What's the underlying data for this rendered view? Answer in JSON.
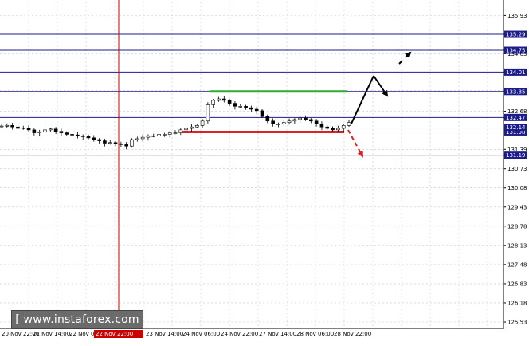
{
  "chart_data": {
    "type": "candlestick",
    "instrument_note": "",
    "y_axis": {
      "ylim": [
        125.53,
        136.4
      ],
      "tick_labels": [
        "135.93",
        "134.63",
        "133.38",
        "132.68",
        "131.39",
        "130.73",
        "130.08",
        "129.43",
        "128.78",
        "128.13",
        "127.48",
        "126.83",
        "126.18",
        "125.53"
      ],
      "tick_values": [
        135.93,
        134.63,
        133.38,
        132.68,
        131.39,
        130.73,
        130.08,
        129.43,
        128.78,
        128.13,
        127.48,
        126.83,
        126.18,
        125.53
      ]
    },
    "x_axis": {
      "tick_labels": [
        "20 Nov 22:00",
        "21 Nov 14:00",
        "22 Nov 06:00",
        "23 Nov 14:00",
        "24 Nov 06:00",
        "24 Nov 22:00",
        "27 Nov 14:00",
        "28 Nov 06:00",
        "28 Nov 22:00"
      ],
      "highlighted_label": "22 Nov 22:00"
    },
    "levels": [
      {
        "value": 135.29,
        "label": "135.29"
      },
      {
        "value": 134.75,
        "label": "134.75"
      },
      {
        "value": 134.01,
        "label": "134.01"
      },
      {
        "value": 133.35,
        "label": "133.35"
      },
      {
        "value": 132.47,
        "label": "132.47"
      },
      {
        "value": 131.98,
        "label": "131.98"
      },
      {
        "value": 131.19,
        "label": "131.19"
      }
    ],
    "current_price_label": "132.14",
    "horizontal_segments": [
      {
        "name": "resistance",
        "value": 133.35,
        "color": "#33aa33"
      },
      {
        "name": "support",
        "value": 131.98,
        "color": "#dd2222"
      }
    ],
    "vertical_line": {
      "color": "#cc0000",
      "label": "22 Nov 22:00"
    },
    "forecast_arrows": [
      {
        "name": "up-swing",
        "color": "#000000",
        "style": "solid"
      },
      {
        "name": "pullback",
        "color": "#000000",
        "style": "solid"
      },
      {
        "name": "continuation",
        "color": "#000000",
        "style": "dashed"
      },
      {
        "name": "breakdown",
        "color": "#dd2222",
        "style": "dashed"
      }
    ],
    "close_path": [
      132.18,
      132.2,
      132.15,
      132.1,
      132.12,
      132.05,
      131.95,
      131.98,
      132.05,
      132.08,
      132.0,
      131.95,
      131.9,
      131.88,
      131.85,
      131.82,
      131.78,
      131.72,
      131.68,
      131.6,
      131.62,
      131.58,
      131.55,
      131.5,
      131.72,
      131.75,
      131.8,
      131.85,
      131.85,
      131.9,
      131.9,
      131.95,
      131.95,
      132.05,
      132.1,
      132.15,
      132.2,
      132.35,
      132.9,
      133.05,
      133.1,
      133.05,
      132.95,
      132.85,
      132.85,
      132.8,
      132.75,
      132.7,
      132.5,
      132.35,
      132.25,
      132.25,
      132.3,
      132.35,
      132.4,
      132.45,
      132.4,
      132.35,
      132.25,
      132.15,
      132.1,
      132.05,
      132.1,
      132.2,
      132.3
    ]
  },
  "watermark": {
    "text": "[ www.instaforex.com ]"
  },
  "colors": {
    "level_line": "#1c1c8c",
    "level_tag_bg": "#1c1c8c",
    "grid": "#c8c8c8",
    "candle": "#000000",
    "watermark_bg": "#6b6b6b"
  }
}
